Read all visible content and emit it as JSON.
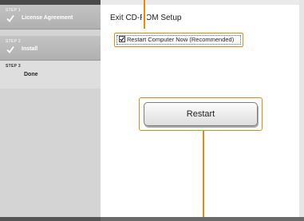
{
  "sidebar": {
    "steps": [
      {
        "step": "STEP 1",
        "label": "License Agreement",
        "state": "done",
        "icon": "check-icon"
      },
      {
        "step": "STEP 2",
        "label": "Install",
        "state": "done",
        "icon": "check-icon"
      },
      {
        "step": "STEP 3",
        "label": "Done",
        "state": "active"
      }
    ]
  },
  "main": {
    "title": "Exit CD-ROM Setup",
    "restart_checkbox": {
      "label": "Restart Computer Now (Recommended)",
      "checked": true
    },
    "restart_button": "Restart"
  },
  "colors": {
    "callout": "#e88a10",
    "sidebar": "#d4d4d4",
    "step_done": "#b8b8b8"
  }
}
